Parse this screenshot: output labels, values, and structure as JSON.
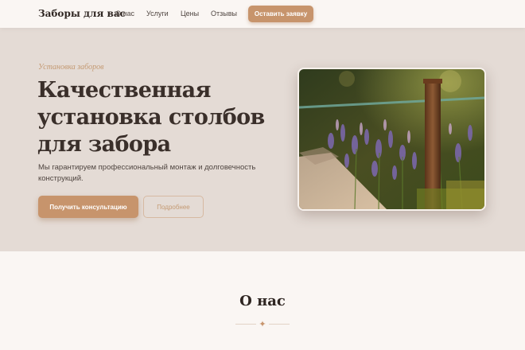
{
  "header": {
    "brand": "Заборы для вас",
    "nav": [
      "О нас",
      "Услуги",
      "Цены",
      "Отзывы"
    ],
    "cta_label": "Оставить заявку"
  },
  "hero": {
    "eyebrow": "Установка заборов",
    "title": "Качественная установка столбов для забора",
    "subtitle": "Мы гарантируем профессиональный монтаж и долговечность конструкций.",
    "primary_button": "Получить консультацию",
    "secondary_button": "Подробнее"
  },
  "about": {
    "title": "О нас"
  },
  "icons": {
    "divider": "star-icon"
  },
  "colors": {
    "accent": "#c7946c",
    "hero_bg": "#e4dbd5",
    "page_bg": "#faf6f3",
    "text_dark": "#3a2f2a"
  }
}
